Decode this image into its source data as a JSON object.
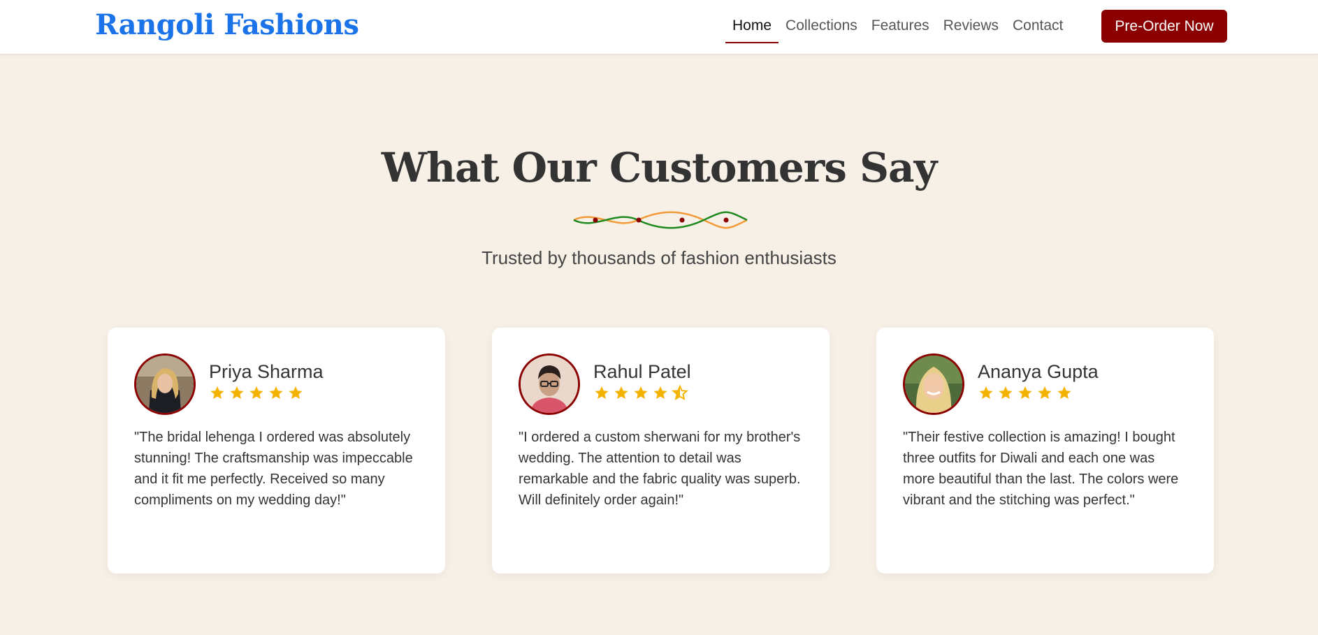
{
  "brand": {
    "name": "Rangoli Fashions",
    "color": "#1a73e8"
  },
  "nav": {
    "items": [
      {
        "label": "Home",
        "active": true
      },
      {
        "label": "Collections",
        "active": false
      },
      {
        "label": "Features",
        "active": false
      },
      {
        "label": "Reviews",
        "active": false
      },
      {
        "label": "Contact",
        "active": false
      }
    ],
    "cta_label": "Pre-Order Now"
  },
  "section": {
    "title": "What Our Customers Say",
    "subtitle": "Trusted by thousands of fashion enthusiasts"
  },
  "testimonials": [
    {
      "name": "Priya Sharma",
      "rating": 5,
      "avatar_icon": "avatar-photo",
      "quote": "\"The bridal lehenga I ordered was absolutely stunning! The craftsmanship was impeccable and it fit me perfectly. Received so many compliments on my wedding day!\""
    },
    {
      "name": "Rahul Patel",
      "rating": 4.5,
      "avatar_icon": "avatar-photo",
      "quote": "\"I ordered a custom sherwani for my brother's wedding. The attention to detail was remarkable and the fabric quality was superb. Will definitely order again!\""
    },
    {
      "name": "Ananya Gupta",
      "rating": 5,
      "avatar_icon": "avatar-photo",
      "quote": "\"Their festive collection is amazing! I bought three outfits for Diwali and each one was more beautiful than the last. The colors were vibrant and the stitching was perfect.\""
    }
  ],
  "colors": {
    "accent": "#8b0000",
    "star": "#f5b301",
    "background": "#f7f0e6",
    "divider_green": "#1f8a1f",
    "divider_orange": "#f29b38"
  }
}
